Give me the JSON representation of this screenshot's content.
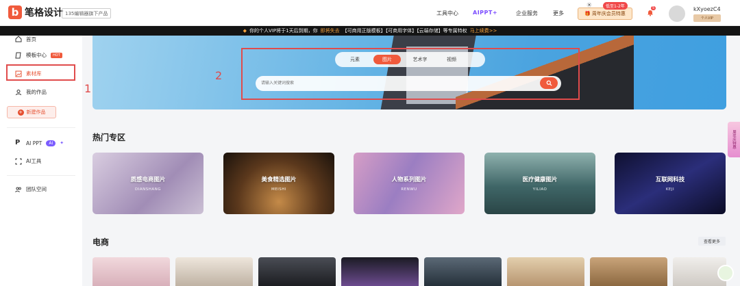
{
  "header": {
    "logo_text": "笔格设计",
    "brand_tag": "135编辑器旗下产品",
    "nav": [
      "工具中心",
      "AIPPT+",
      "企业服务",
      "更多"
    ],
    "anniv_label": "周年庆会员特惠",
    "anniv_badge": "低至1-2年",
    "notification_count": "5",
    "username": "kXyoezC4",
    "vip_label": "个人VIP"
  },
  "notice": {
    "text_a": "你的个人VIP将于1天后到期，你",
    "text_hl": "即将失去",
    "text_b": "【可商用正版模板】【可商用字体】【云端存储】等专属特权",
    "cta": "马上续费>>"
  },
  "sidebar": {
    "items": [
      {
        "label": "首页",
        "icon": "home-icon"
      },
      {
        "label": "模板中心",
        "icon": "template-icon",
        "badge": "HOT"
      },
      {
        "label": "素材库",
        "icon": "image-icon"
      },
      {
        "label": "我的作品",
        "icon": "user-icon"
      }
    ],
    "new_button": "新建作品",
    "ai_items": [
      {
        "label": "AI PPT",
        "badge": "AI"
      },
      {
        "label": "AI工具"
      }
    ],
    "team": "团队空间"
  },
  "annotations": {
    "label1": "1",
    "label2": "2"
  },
  "search": {
    "tabs": [
      "元素",
      "图片",
      "艺术字",
      "视频"
    ],
    "active_tab": 1,
    "placeholder": "请输入关键词搜索"
  },
  "hot_section": {
    "title": "热门专区",
    "cards": [
      {
        "title": "质感电商图片",
        "sub": "DIANSHANG",
        "color": "#b9a8c4"
      },
      {
        "title": "美食精选图片",
        "sub": "MEISHI",
        "color": "#6b4424"
      },
      {
        "title": "人物系列图片",
        "sub": "RENWU",
        "color": "#b78ab6"
      },
      {
        "title": "医疗健康图片",
        "sub": "YILIAO",
        "color": "#3e6b6c"
      },
      {
        "title": "互联网科技",
        "sub": "KEJI",
        "color": "#1d1f4a"
      }
    ]
  },
  "ecommerce_section": {
    "title": "电商",
    "more": "查看更多",
    "thumbs": [
      "#e8c6cc",
      "#d7ccc1",
      "#2a2c30",
      "#111117",
      "#3c4854",
      "#c9b08e",
      "#b48d62",
      "#dedcd8"
    ]
  },
  "float_side": "周年庆特惠"
}
